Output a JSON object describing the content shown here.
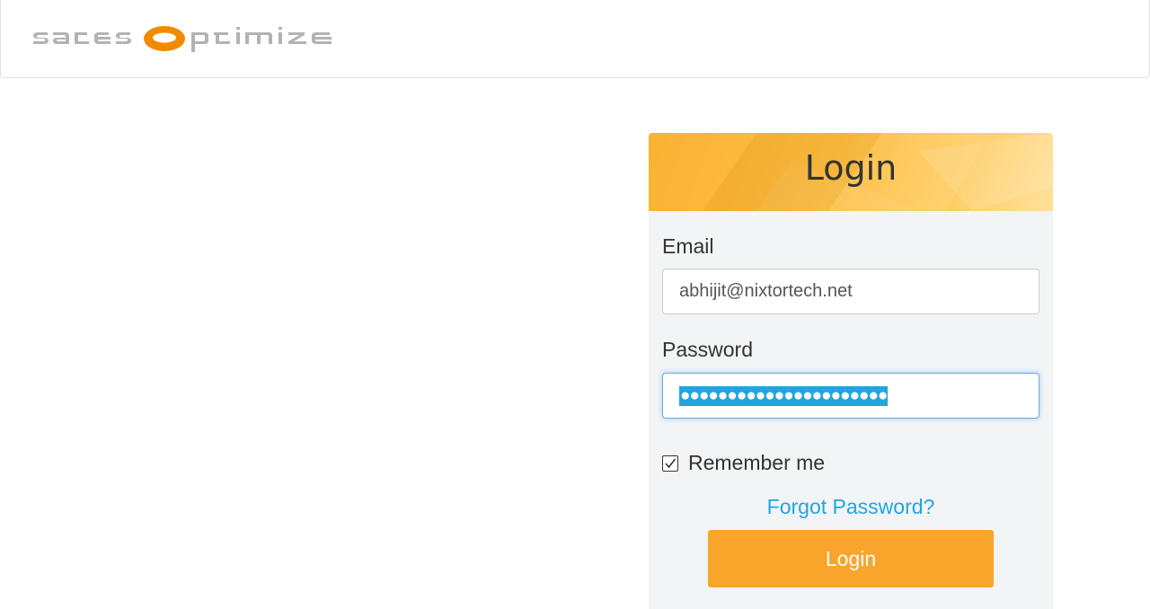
{
  "brand": {
    "logo_text": "salesoptimize",
    "colors": {
      "logo_gray": "#b0b0b0",
      "logo_orange": "#f28a00"
    }
  },
  "login": {
    "title": "Login",
    "email_label": "Email",
    "email_value": "abhijit@nixtortech.net",
    "password_label": "Password",
    "password_masked": "●●●●●●●●●●●●●●●●●●●●●●",
    "remember_label": "Remember me",
    "remember_checked": true,
    "forgot_link": "Forgot Password?",
    "submit_label": "Login"
  },
  "colors": {
    "header_gradient_start": "#fbae2a",
    "header_gradient_end": "#ffe09b",
    "panel_bg": "#f3f4f6",
    "button_bg": "#f9a52b",
    "link_color": "#1fa6e0",
    "selection_bg": "#1fa6e0"
  },
  "icons": {
    "logo": "salesoptimize-logo",
    "checkbox": "check-icon"
  }
}
